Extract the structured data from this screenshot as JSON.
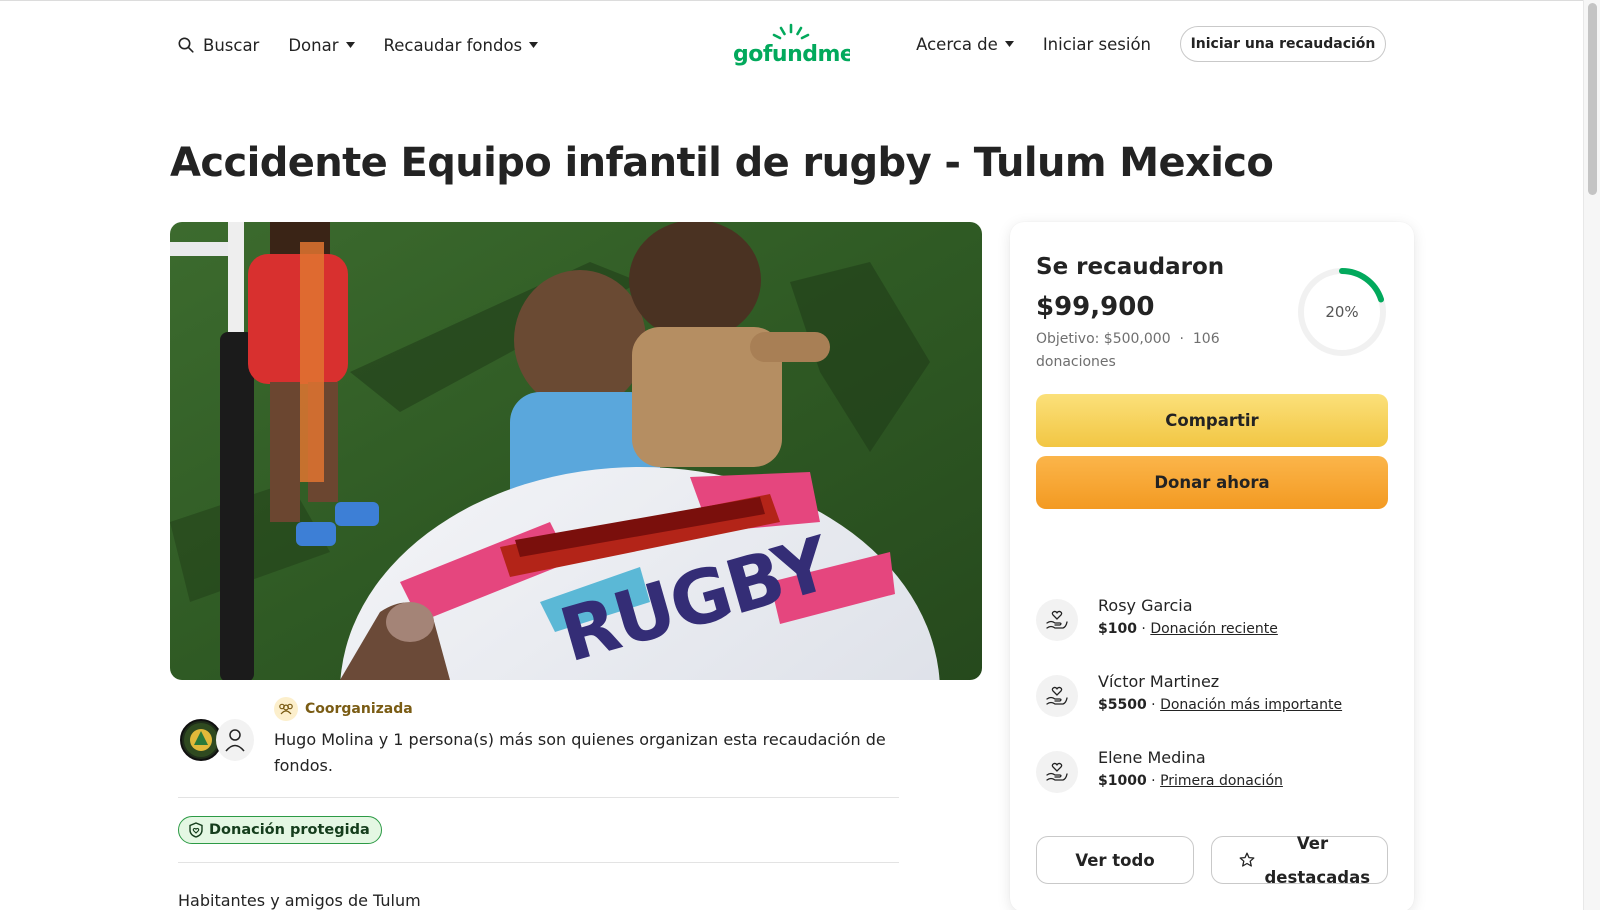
{
  "header": {
    "search_label": "Buscar",
    "donate_menu": "Donar",
    "fundraise_menu": "Recaudar fondos",
    "logo_text": "gofundme",
    "about_menu": "Acerca de",
    "login_label": "Iniciar sesión",
    "start_button": "Iniciar una recaudación"
  },
  "campaign": {
    "title": "Accidente Equipo infantil de rugby - Tulum Mexico",
    "hero_image": "children-rugby-field-photo"
  },
  "organizer": {
    "badge": "Coorganizada",
    "text": "Hugo Molina y 1 persona(s) más son quienes organizan esta recaudación de fondos.",
    "protected_badge": "Donación protegida",
    "beneficiary": "Habitantes y amigos de Tulum"
  },
  "donation_card": {
    "raised_label": "Se recaudaron",
    "raised_amount": "$99,900",
    "goal_text": "Objetivo: $500,000",
    "separator": "·",
    "donations_count": "106",
    "donations_word": "donaciones",
    "progress_percent": 20,
    "progress_label": "20%",
    "share_button": "Compartir",
    "donate_button": "Donar ahora",
    "donations": [
      {
        "name": "Rosy Garcia",
        "amount": "$100",
        "separator": "·",
        "tag": "Donación reciente"
      },
      {
        "name": "Víctor Martinez",
        "amount": "$5500",
        "separator": "·",
        "tag": "Donación más importante"
      },
      {
        "name": "Elene Medina",
        "amount": "$1000",
        "separator": "·",
        "tag": "Primera donación"
      }
    ],
    "see_all_button": "Ver todo",
    "see_top_button_line1": "Ver",
    "see_top_button_line2": "destacadas"
  },
  "colors": {
    "brand_green": "#02a95c",
    "share_yellow": "#f6d35b",
    "donate_orange": "#f5a83a",
    "protected_green": "#2c9a45"
  },
  "icons": {
    "search": "search-icon",
    "caret": "caret-down-icon",
    "co_organized": "people-group-icon",
    "shield": "shield-heart-icon",
    "donor": "hand-heart-icon",
    "star": "star-icon"
  }
}
